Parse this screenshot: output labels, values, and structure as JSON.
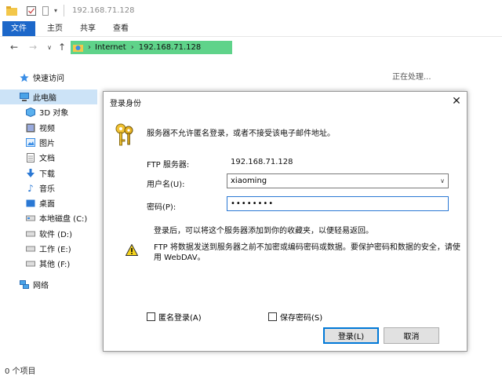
{
  "window": {
    "title": "192.168.71.128",
    "ribbon_tabs": [
      "文件",
      "主页",
      "共享",
      "查看"
    ]
  },
  "address": {
    "crumbs": [
      "Internet",
      "192.168.71.128"
    ]
  },
  "sidebar": {
    "items": [
      {
        "label": "快速访问",
        "icon": "star-icon"
      },
      {
        "label": "此电脑",
        "icon": "pc-icon"
      },
      {
        "label": "3D 对象",
        "icon": "cube-icon"
      },
      {
        "label": "视频",
        "icon": "video-icon"
      },
      {
        "label": "图片",
        "icon": "picture-icon"
      },
      {
        "label": "文档",
        "icon": "document-icon"
      },
      {
        "label": "下载",
        "icon": "download-icon"
      },
      {
        "label": "音乐",
        "icon": "music-icon"
      },
      {
        "label": "桌面",
        "icon": "desktop-icon"
      },
      {
        "label": "本地磁盘 (C:)",
        "icon": "drive-icon"
      },
      {
        "label": "软件 (D:)",
        "icon": "drive-icon"
      },
      {
        "label": "工作 (E:)",
        "icon": "drive-icon"
      },
      {
        "label": "其他 (F:)",
        "icon": "drive-icon"
      },
      {
        "label": "网络",
        "icon": "network-icon"
      }
    ]
  },
  "content": {
    "processing": "正在处理...",
    "status": "0 个项目"
  },
  "dialog": {
    "title": "登录身份",
    "intro": "服务器不允许匿名登录，或者不接受该电子邮件地址。",
    "server_label": "FTP 服务器:",
    "server_value": "192.168.71.128",
    "user_label": "用户名(U):",
    "user_value": "xiaoming",
    "password_label": "密码(P):",
    "password_value": "••••••••",
    "info": "登录后，可以将这个服务器添加到你的收藏夹，以便轻易返回。",
    "warning": "FTP 将数据发送到服务器之前不加密或编码密码或数据。要保护密码和数据的安全，请使用 WebDAV。",
    "anon_label": "匿名登录(A)",
    "save_label": "保存密码(S)",
    "login_button": "登录(L)",
    "cancel_button": "取消"
  },
  "colors": {
    "accent": "#1c67c9",
    "address_highlight": "#5fd38a",
    "selected": "#cce3f7"
  }
}
